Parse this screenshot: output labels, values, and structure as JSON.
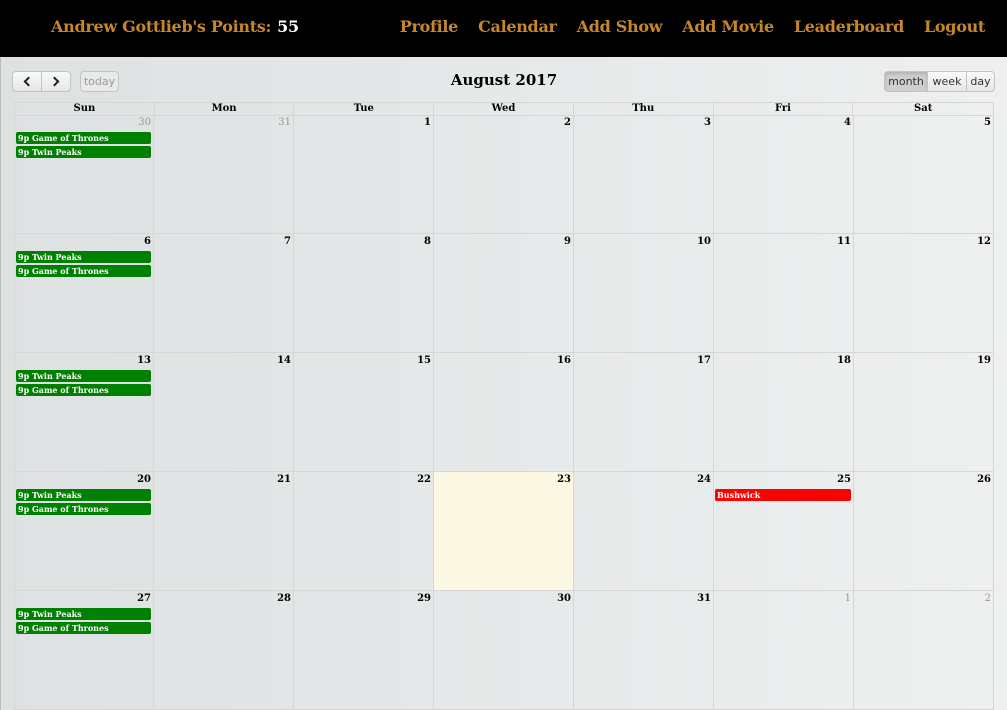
{
  "navbar": {
    "brand_label": "Andrew Gottlieb's Points:",
    "points": "55",
    "links": [
      "Profile",
      "Calendar",
      "Add Show",
      "Add Movie",
      "Leaderboard",
      "Logout"
    ]
  },
  "toolbar": {
    "today_label": "today",
    "title": "August 2017",
    "views": [
      "month",
      "week",
      "day"
    ],
    "active_view": "month"
  },
  "colors": {
    "accent": "#c7862a",
    "event_green": "#008000",
    "event_red": "#ff0000",
    "today_bg": "#fcf8e3"
  },
  "calendar": {
    "days_of_week": [
      "Sun",
      "Mon",
      "Tue",
      "Wed",
      "Thu",
      "Fri",
      "Sat"
    ],
    "weeks": [
      [
        {
          "num": "30",
          "other": true,
          "events": [
            {
              "text": "9p Game of Thrones",
              "color": "#008000"
            },
            {
              "text": "9p Twin Peaks",
              "color": "#008000"
            }
          ]
        },
        {
          "num": "31",
          "other": true,
          "events": []
        },
        {
          "num": "1",
          "events": []
        },
        {
          "num": "2",
          "events": []
        },
        {
          "num": "3",
          "events": []
        },
        {
          "num": "4",
          "events": []
        },
        {
          "num": "5",
          "events": []
        }
      ],
      [
        {
          "num": "6",
          "events": [
            {
              "text": "9p Twin Peaks",
              "color": "#008000"
            },
            {
              "text": "9p Game of Thrones",
              "color": "#008000"
            }
          ]
        },
        {
          "num": "7",
          "events": []
        },
        {
          "num": "8",
          "events": []
        },
        {
          "num": "9",
          "events": []
        },
        {
          "num": "10",
          "events": []
        },
        {
          "num": "11",
          "events": []
        },
        {
          "num": "12",
          "events": []
        }
      ],
      [
        {
          "num": "13",
          "events": [
            {
              "text": "9p Twin Peaks",
              "color": "#008000"
            },
            {
              "text": "9p Game of Thrones",
              "color": "#008000"
            }
          ]
        },
        {
          "num": "14",
          "events": []
        },
        {
          "num": "15",
          "events": []
        },
        {
          "num": "16",
          "events": []
        },
        {
          "num": "17",
          "events": []
        },
        {
          "num": "18",
          "events": []
        },
        {
          "num": "19",
          "events": []
        }
      ],
      [
        {
          "num": "20",
          "events": [
            {
              "text": "9p Twin Peaks",
              "color": "#008000"
            },
            {
              "text": "9p Game of Thrones",
              "color": "#008000"
            }
          ]
        },
        {
          "num": "21",
          "events": []
        },
        {
          "num": "22",
          "events": []
        },
        {
          "num": "23",
          "today": true,
          "events": []
        },
        {
          "num": "24",
          "events": []
        },
        {
          "num": "25",
          "events": [
            {
              "text": "Bushwick",
              "color": "#ff0000"
            }
          ]
        },
        {
          "num": "26",
          "events": []
        }
      ],
      [
        {
          "num": "27",
          "events": [
            {
              "text": "9p Twin Peaks",
              "color": "#008000"
            },
            {
              "text": "9p Game of Thrones",
              "color": "#008000"
            }
          ]
        },
        {
          "num": "28",
          "events": []
        },
        {
          "num": "29",
          "events": []
        },
        {
          "num": "30",
          "events": []
        },
        {
          "num": "31",
          "events": []
        },
        {
          "num": "1",
          "other": true,
          "events": []
        },
        {
          "num": "2",
          "other": true,
          "events": []
        }
      ]
    ]
  }
}
